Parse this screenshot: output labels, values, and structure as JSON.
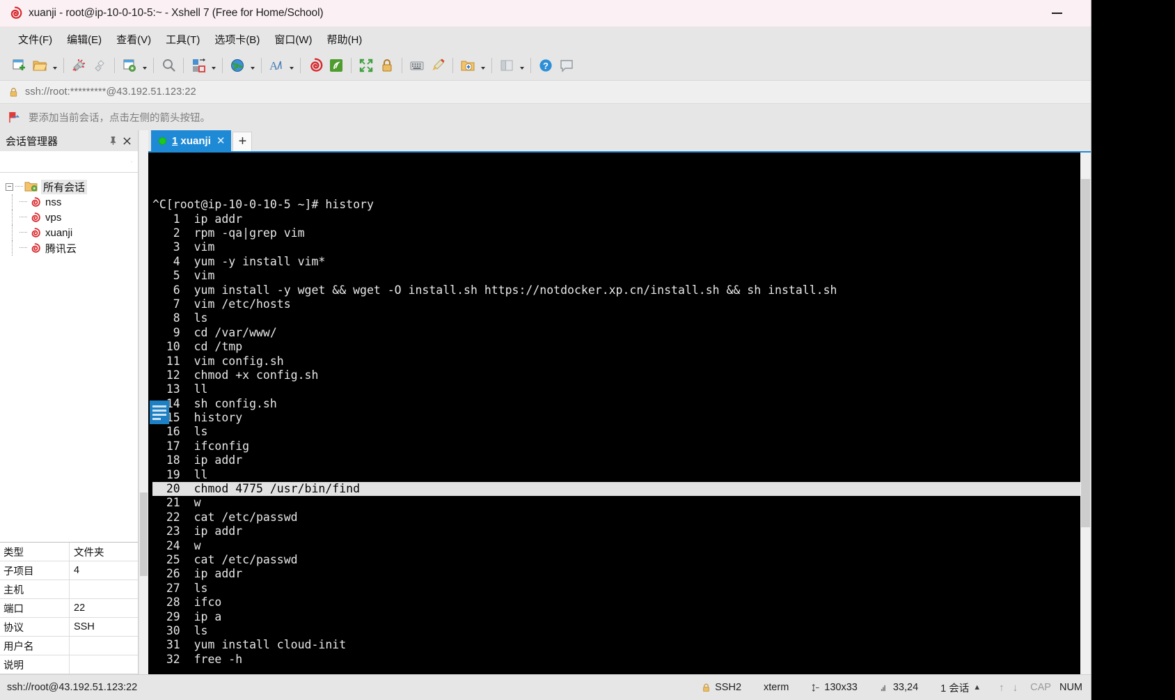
{
  "window": {
    "title": "xuanji - root@ip-10-0-10-5:~ - Xshell 7 (Free for Home/School)",
    "minimize_label": "—",
    "app_icon": "xshell-spiral-icon"
  },
  "menubar": {
    "items": [
      {
        "label": "文件(F)",
        "name": "menu-file"
      },
      {
        "label": "编辑(E)",
        "name": "menu-edit"
      },
      {
        "label": "查看(V)",
        "name": "menu-view"
      },
      {
        "label": "工具(T)",
        "name": "menu-tools"
      },
      {
        "label": "选项卡(B)",
        "name": "menu-tab"
      },
      {
        "label": "窗口(W)",
        "name": "menu-window"
      },
      {
        "label": "帮助(H)",
        "name": "menu-help"
      }
    ]
  },
  "toolbar": {
    "icons": [
      "new-session-icon",
      "open-folder-icon",
      "disconnect-icon",
      "reconnect-icon",
      "session-properties-icon",
      "find-icon",
      "transfer-file-icon",
      "globe-icon",
      "font-icon",
      "xshell-icon",
      "xftp-icon",
      "fullscreen-icon",
      "lock-icon",
      "keyboard-icon",
      "highlight-icon",
      "add-folder-icon",
      "layout-icon",
      "help-icon",
      "comment-icon"
    ]
  },
  "addressbar": {
    "lock_icon": "lock-icon",
    "url": "ssh://root:*********@43.192.51.123:22"
  },
  "notice": {
    "icon": "arrow-flag-icon",
    "text": "要添加当前会话，点击左侧的箭头按钮。"
  },
  "sidebar": {
    "title": "会话管理器",
    "pin_label": "📌",
    "close_label": "✕",
    "search": {
      "value": "",
      "placeholder": "",
      "icon": "search-icon"
    },
    "tree": {
      "root": {
        "label": "所有会话",
        "icon": "folder-gear-icon",
        "toggle": "−",
        "selected": true
      },
      "children": [
        {
          "label": "nss",
          "icon": "session-spiral-icon"
        },
        {
          "label": "vps",
          "icon": "session-spiral-icon"
        },
        {
          "label": "xuanji",
          "icon": "session-spiral-icon"
        },
        {
          "label": "腾讯云",
          "icon": "session-spiral-icon"
        }
      ]
    },
    "properties": [
      {
        "key": "类型",
        "value": "文件夹"
      },
      {
        "key": "子项目",
        "value": "4"
      },
      {
        "key": "主机",
        "value": ""
      },
      {
        "key": "端口",
        "value": "22"
      },
      {
        "key": "协议",
        "value": "SSH"
      },
      {
        "key": "用户名",
        "value": ""
      },
      {
        "key": "说明",
        "value": ""
      }
    ]
  },
  "tabs": {
    "items": [
      {
        "index": "1",
        "label": "xuanji",
        "status": "connected",
        "close_label": "✕"
      }
    ],
    "add_label": "+"
  },
  "terminal": {
    "prompt_line": "^C[root@ip-10-0-10-5 ~]# history",
    "highlighted_index": 20,
    "history": [
      {
        "n": "1",
        "cmd": "ip addr"
      },
      {
        "n": "2",
        "cmd": "rpm -qa|grep vim"
      },
      {
        "n": "3",
        "cmd": "vim"
      },
      {
        "n": "4",
        "cmd": "yum -y install vim*"
      },
      {
        "n": "5",
        "cmd": "vim"
      },
      {
        "n": "6",
        "cmd": "yum install -y wget && wget -O install.sh https://notdocker.xp.cn/install.sh && sh install.sh"
      },
      {
        "n": "7",
        "cmd": "vim /etc/hosts"
      },
      {
        "n": "8",
        "cmd": "ls"
      },
      {
        "n": "9",
        "cmd": "cd /var/www/"
      },
      {
        "n": "10",
        "cmd": "cd /tmp"
      },
      {
        "n": "11",
        "cmd": "vim config.sh"
      },
      {
        "n": "12",
        "cmd": "chmod +x config.sh"
      },
      {
        "n": "13",
        "cmd": "ll"
      },
      {
        "n": "14",
        "cmd": "sh config.sh"
      },
      {
        "n": "15",
        "cmd": "history"
      },
      {
        "n": "16",
        "cmd": "ls"
      },
      {
        "n": "17",
        "cmd": "ifconfig"
      },
      {
        "n": "18",
        "cmd": "ip addr"
      },
      {
        "n": "19",
        "cmd": "ll"
      },
      {
        "n": "20",
        "cmd": "chmod 4775 /usr/bin/find"
      },
      {
        "n": "21",
        "cmd": "w"
      },
      {
        "n": "22",
        "cmd": "cat /etc/passwd"
      },
      {
        "n": "23",
        "cmd": "ip addr"
      },
      {
        "n": "24",
        "cmd": "w"
      },
      {
        "n": "25",
        "cmd": "cat /etc/passwd"
      },
      {
        "n": "26",
        "cmd": "ip addr"
      },
      {
        "n": "27",
        "cmd": "ls"
      },
      {
        "n": "28",
        "cmd": "ifco"
      },
      {
        "n": "29",
        "cmd": "ip a"
      },
      {
        "n": "30",
        "cmd": "ls"
      },
      {
        "n": "31",
        "cmd": "yum install cloud-init"
      },
      {
        "n": "32",
        "cmd": "free -h"
      }
    ]
  },
  "statusbar": {
    "url": "ssh://root@43.192.51.123:22",
    "protocol": "SSH2",
    "term_type": "xterm",
    "size": "130x33",
    "cursor": "33,24",
    "sessions": "1 会话",
    "caps": "CAP",
    "num": "NUM",
    "up_arrow": "↑",
    "down_arrow": "↓",
    "expand_arrow": "▲"
  },
  "colors": {
    "accent": "#1e8ad6",
    "titlebar": "#fbf0f3",
    "chrome": "#e6e6e6",
    "terminal_bg": "#000000",
    "terminal_fg": "#e8e8e8",
    "selection_bg": "#e2e2e2"
  }
}
